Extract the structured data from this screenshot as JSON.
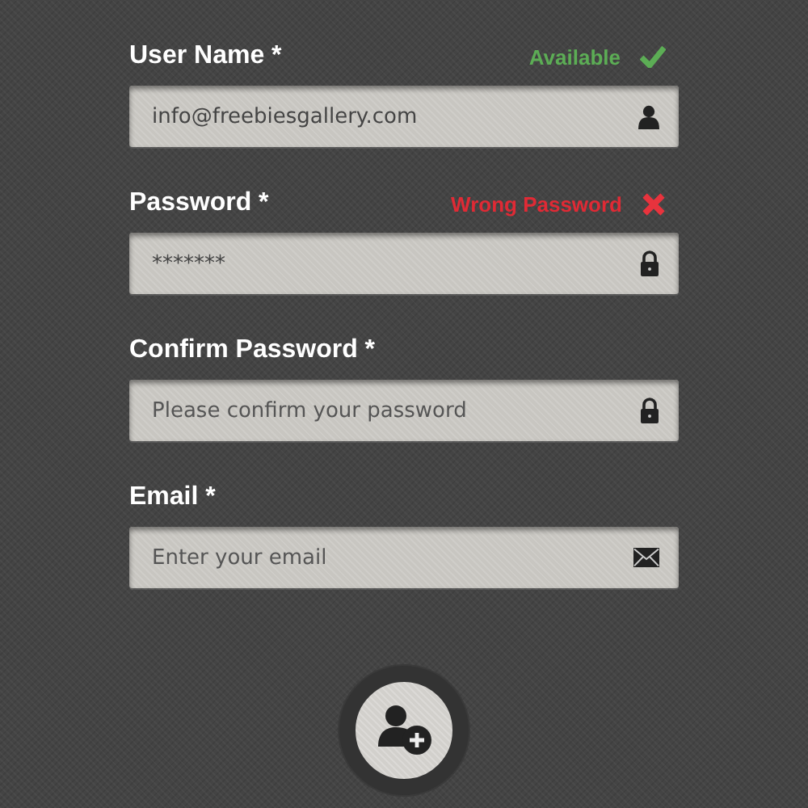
{
  "fields": [
    {
      "kind": "username",
      "label": "User Name *",
      "value": "info@freebiesgallery.com",
      "status": {
        "kind": "valid",
        "text": "Available"
      }
    },
    {
      "kind": "password",
      "label": "Password *",
      "value": "*******",
      "status": {
        "kind": "invalid",
        "text": "Wrong Password"
      }
    },
    {
      "kind": "password",
      "label": "Confirm Password *",
      "placeholder": "Please confirm your password"
    },
    {
      "kind": "email",
      "label": "Email *",
      "placeholder": "Enter your email"
    }
  ],
  "submit": {
    "kind": "add-user"
  }
}
